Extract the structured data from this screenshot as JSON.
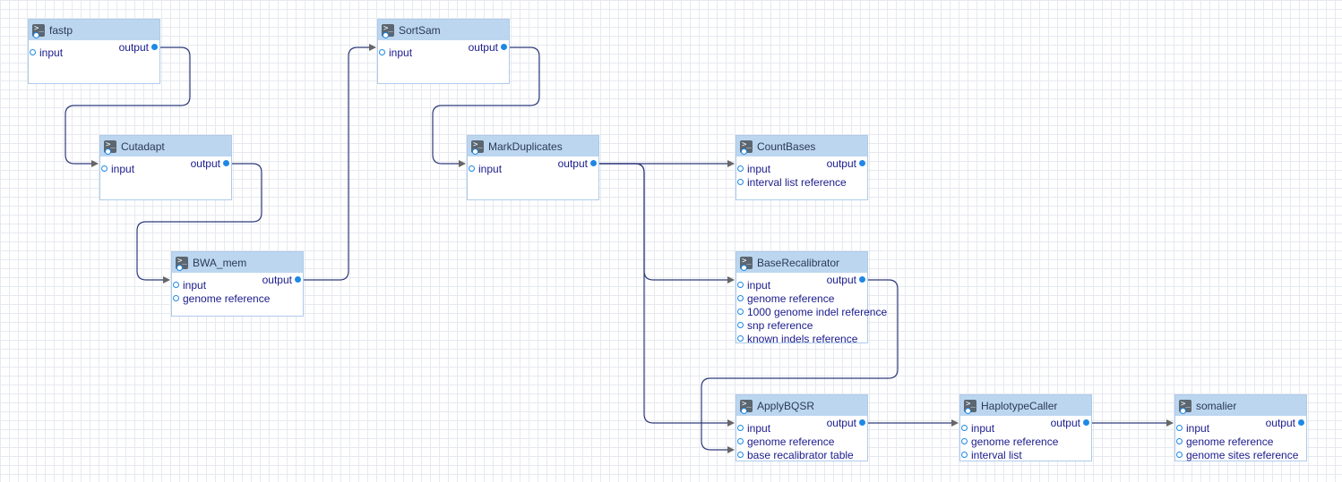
{
  "nodes": [
    {
      "id": "fastp",
      "title": "fastp",
      "inputs": [
        "input"
      ],
      "output": "output"
    },
    {
      "id": "cutadapt",
      "title": "Cutadapt",
      "inputs": [
        "input"
      ],
      "output": "output"
    },
    {
      "id": "bwa",
      "title": "BWA_mem",
      "inputs": [
        "input",
        "genome reference"
      ],
      "output": "output"
    },
    {
      "id": "sortsam",
      "title": "SortSam",
      "inputs": [
        "input"
      ],
      "output": "output"
    },
    {
      "id": "markdup",
      "title": "MarkDuplicates",
      "inputs": [
        "input"
      ],
      "output": "output"
    },
    {
      "id": "countbases",
      "title": "CountBases",
      "inputs": [
        "input",
        "interval list reference"
      ],
      "output": "output"
    },
    {
      "id": "baserecal",
      "title": "BaseRecalibrator",
      "inputs": [
        "input",
        "genome reference",
        "1000 genome indel reference",
        "snp reference",
        "known indels reference"
      ],
      "output": "output"
    },
    {
      "id": "applybqsr",
      "title": "ApplyBQSR",
      "inputs": [
        "input",
        "genome reference",
        "base recalibrator table"
      ],
      "output": "output"
    },
    {
      "id": "haplotype",
      "title": "HaplotypeCaller",
      "inputs": [
        "input",
        "genome reference",
        "interval list"
      ],
      "output": "output"
    },
    {
      "id": "somalier",
      "title": "somalier",
      "inputs": [
        "input",
        "genome reference",
        "genome sites reference"
      ],
      "output": "output"
    }
  ],
  "edges": [
    {
      "from": "fastp",
      "to": "cutadapt",
      "port": 0
    },
    {
      "from": "cutadapt",
      "to": "bwa",
      "port": 0
    },
    {
      "from": "bwa",
      "to": "sortsam",
      "port": 0
    },
    {
      "from": "sortsam",
      "to": "markdup",
      "port": 0
    },
    {
      "from": "markdup",
      "to": "countbases",
      "port": 0
    },
    {
      "from": "markdup",
      "to": "baserecal",
      "port": 0
    },
    {
      "from": "markdup",
      "to": "applybqsr",
      "port": 0
    },
    {
      "from": "baserecal",
      "to": "applybqsr",
      "port": 2
    },
    {
      "from": "applybqsr",
      "to": "haplotype",
      "port": 0
    },
    {
      "from": "haplotype",
      "to": "somalier",
      "port": 0
    }
  ],
  "colors": {
    "edge": "#2e3a7a",
    "arrow": "#666666",
    "accent": "#1e88e5",
    "header": "#bcd6f0"
  },
  "icon": "terminal-icon"
}
